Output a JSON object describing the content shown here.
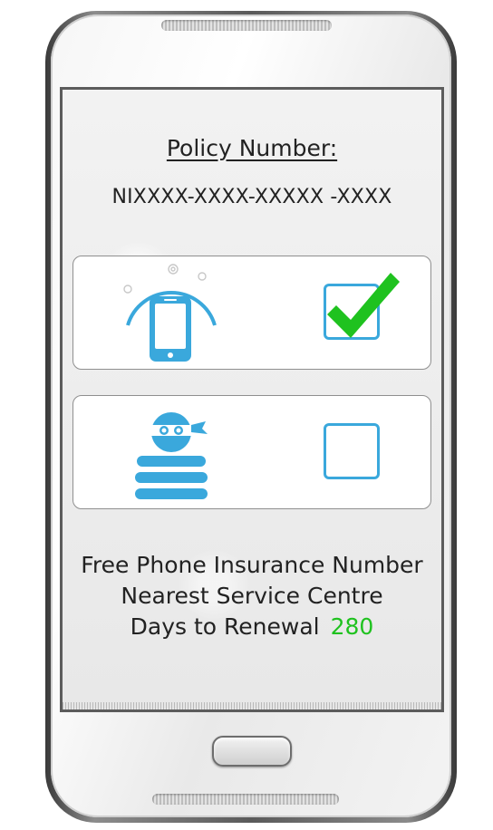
{
  "policy": {
    "title": "Policy Number:",
    "number": "NIXXXX-XXXX-XXXXX -XXXX"
  },
  "options": [
    {
      "icon": "phone-protection-icon",
      "checked": true
    },
    {
      "icon": "thief-icon",
      "checked": false
    }
  ],
  "links": {
    "insurance_number": "Free Phone Insurance Number",
    "service_centre": "Nearest Service Centre"
  },
  "renewal": {
    "label": "Days to Renewal",
    "days": "280"
  },
  "colors": {
    "accent_blue": "#3aa8dc",
    "check_green": "#1fc21f",
    "days_green": "#1fc21f"
  }
}
